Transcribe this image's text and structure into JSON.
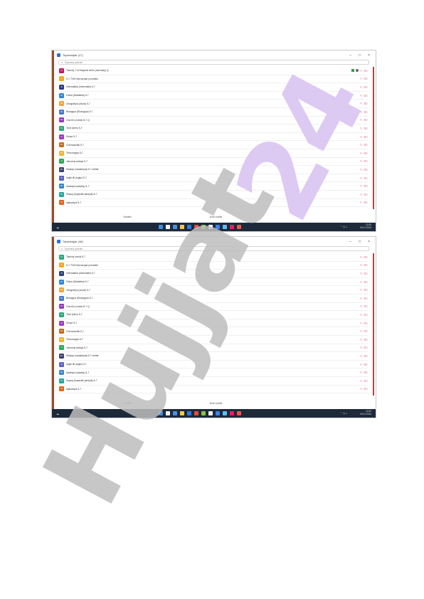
{
  "screens": [
    {
      "title": "Topshiriqlar (17)",
      "search_placeholder": "Topshiriq qidirish",
      "rows": [
        {
          "name": "Tasviriy 7 kl Raqamli ta'lim (ma'naviy) Q",
          "badge": "TA",
          "color": "#c2185b",
          "status": true
        },
        {
          "name": "5-7-TVM Ma'naviyat yo'nalishi",
          "badge": "5",
          "color": "#f5a623",
          "status": false
        },
        {
          "name": "Informatika (Informatik) 5-7",
          "badge": "IN",
          "color": "#2a3e7a",
          "status": false
        },
        {
          "name": "Fizika (Statistika) 5-7",
          "badge": "FZ",
          "color": "#2f86d6",
          "status": false
        },
        {
          "name": "Geografiya (Asosi) 5-7",
          "badge": "GE",
          "color": "#f2a53a",
          "status": false
        },
        {
          "name": "Biologiya (Ekologiya) 5-7",
          "badge": "BI",
          "color": "#4a78c9",
          "status": false
        },
        {
          "name": "Ona tili (o'zbek) 5-7 Q",
          "badge": "ON",
          "color": "#8e3bb8",
          "status": false
        },
        {
          "name": "Tarix (tarix) 5-7",
          "badge": "TA",
          "color": "#2aa879",
          "status": false
        },
        {
          "name": "Kimyo 5-7",
          "badge": "KI",
          "color": "#9c3bc2",
          "status": false
        },
        {
          "name": "Chizmachilik 5-7",
          "badge": "CH",
          "color": "#c26a1b",
          "status": false
        },
        {
          "name": "Texnologiya 5-7",
          "badge": "TE",
          "color": "#f0b330",
          "status": false
        },
        {
          "name": "Jismoniy tarbiya 5-7",
          "badge": "JI",
          "color": "#2eaa55",
          "status": false
        },
        {
          "name": "Musiqa (madaniyat) 5-7 sinflar",
          "badge": "MU",
          "color": "#3a3f6a",
          "status": false
        },
        {
          "name": "Ingliz tili (ingliz) 5-7",
          "badge": "IN",
          "color": "#5a5fc2",
          "status": false
        },
        {
          "name": "Adabiyot (adabiy) 5-7",
          "badge": "AD",
          "color": "#3b86c8",
          "status": false
        },
        {
          "name": "Huquq (fuqarolik jamiyat) 5-7",
          "badge": "HU",
          "color": "#22a39a",
          "status": false
        },
        {
          "name": "Iqtisodiyot 5-7",
          "badge": "IQ",
          "color": "#e0631b",
          "status": false
        }
      ],
      "bottom_left": "Yaratish",
      "bottom_right": "Bosh sahifa",
      "clock": "12:00",
      "date": "30.01.2024"
    },
    {
      "title": "Topshiriqlar (18)",
      "search_placeholder": "Topshiriq qidirish",
      "rows": [
        {
          "name": "Tasviriy san'at 5-7",
          "badge": "TA",
          "color": "#2aa879",
          "status": false
        },
        {
          "name": "5-7-TVM Ma'naviyat yo'nalishi",
          "badge": "5",
          "color": "#f5a623",
          "status": false
        },
        {
          "name": "Informatika (Informatik) 5-7",
          "badge": "IN",
          "color": "#2a3e7a",
          "status": false
        },
        {
          "name": "Fizika (Statistika) 5-7",
          "badge": "FZ",
          "color": "#2f86d6",
          "status": false
        },
        {
          "name": "Geografiya (Asosi) 5-7",
          "badge": "GE",
          "color": "#f2a53a",
          "status": false
        },
        {
          "name": "Biologiya (Ekologiya) 5-7",
          "badge": "BI",
          "color": "#4a78c9",
          "status": false
        },
        {
          "name": "Ona tili (o'zbek) 5-7 Q",
          "badge": "ON",
          "color": "#8e3bb8",
          "status": false
        },
        {
          "name": "Tarix (tarix) 5-7",
          "badge": "TA",
          "color": "#2aa879",
          "status": false
        },
        {
          "name": "Kimyo 5-7",
          "badge": "KI",
          "color": "#9c3bc2",
          "status": false
        },
        {
          "name": "Chizmachilik 5-7",
          "badge": "CH",
          "color": "#c26a1b",
          "status": false
        },
        {
          "name": "Texnologiya 5-7",
          "badge": "TE",
          "color": "#f0b330",
          "status": false
        },
        {
          "name": "Jismoniy tarbiya 5-7",
          "badge": "JI",
          "color": "#2eaa55",
          "status": false
        },
        {
          "name": "Musiqa (madaniyat) 5-7 sinflar",
          "badge": "MU",
          "color": "#3a3f6a",
          "status": false
        },
        {
          "name": "Ingliz tili (ingliz) 5-7",
          "badge": "IN",
          "color": "#5a5fc2",
          "status": false
        },
        {
          "name": "Adabiyot (adabiy) 5-7",
          "badge": "AD",
          "color": "#3b86c8",
          "status": false
        },
        {
          "name": "Huquq (fuqarolik jamiyat) 5-7",
          "badge": "HU",
          "color": "#22a39a",
          "status": false
        },
        {
          "name": "Iqtisodiyot 5-7",
          "badge": "IQ",
          "color": "#e0631b",
          "status": false
        }
      ],
      "bottom_left": "Yaratish",
      "bottom_right": "Bosh sahifa",
      "clock": "12:00",
      "date": "30.01.2024"
    }
  ],
  "taskbar_colors": [
    "#3c8fe6",
    "#ffffff",
    "#4a90e2",
    "#f7c948",
    "#2c7be5",
    "#e94b3c",
    "#8bc34a",
    "#ffffff",
    "#3b82f6",
    "#5ec1f0",
    "#e91e63",
    "#ef5350"
  ],
  "watermark": {
    "text": "Hujjat 24",
    "color_gray": "#bdbdbd",
    "color_purple": "#d9c4f2"
  },
  "colors": {
    "accent": "#9c4a2a",
    "taskbar": "#1d2a3a"
  }
}
